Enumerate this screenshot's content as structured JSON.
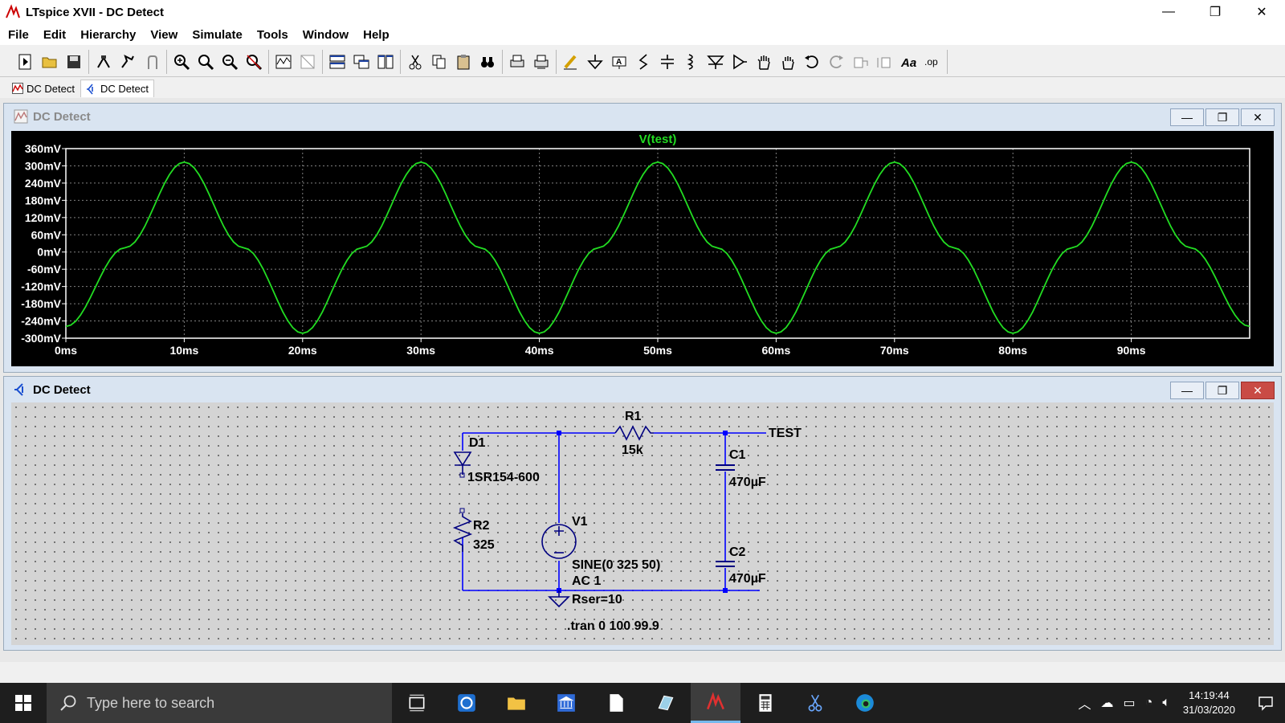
{
  "window": {
    "title": "LTspice XVII - DC Detect",
    "minimize": "—",
    "maximize": "❐",
    "close": "✕"
  },
  "menu": [
    "File",
    "Edit",
    "Hierarchy",
    "View",
    "Simulate",
    "Tools",
    "Window",
    "Help"
  ],
  "toolbar_icons": [
    [
      "new-schematic-icon",
      "open-icon",
      "save-icon"
    ],
    [
      "control-panel-icon",
      "run-icon",
      "halt-icon"
    ],
    [
      "zoom-in-icon",
      "zoom-fit-icon",
      "zoom-out-icon",
      "zoom-cancel-icon"
    ],
    [
      "autorange-icon",
      "waveform-pane-icon"
    ],
    [
      "tile-horizontal-icon",
      "cascade-icon",
      "tile-vertical-icon"
    ],
    [
      "cut-icon",
      "copy-icon",
      "paste-icon",
      "find-icon"
    ],
    [
      "print-icon",
      "print-preview-icon"
    ],
    [
      "draw-wire-icon",
      "ground-icon",
      "label-net-icon",
      "resistor-icon",
      "capacitor-icon",
      "inductor-icon",
      "diode-icon",
      "component-icon",
      "move-icon",
      "drag-icon",
      "undo-icon",
      "redo-icon",
      "rotate-icon",
      "mirror-icon",
      "text-icon",
      "spice-directive-icon"
    ]
  ],
  "tabs": [
    {
      "label": "DC Detect",
      "kind": "waveform"
    },
    {
      "label": "DC Detect",
      "kind": "schematic"
    }
  ],
  "plot_window": {
    "title": "DC Detect"
  },
  "schematic_window": {
    "title": "DC Detect"
  },
  "chart_data": {
    "type": "line",
    "title": "V(test)",
    "series": [
      {
        "name": "V(test)",
        "color": "#22dd22",
        "x": [
          0,
          5,
          10,
          15,
          20,
          25,
          30,
          35,
          40,
          45,
          50,
          55,
          60,
          65,
          70,
          75,
          80,
          85,
          90,
          95,
          100
        ],
        "y": [
          -259,
          15,
          313,
          15,
          -283,
          15,
          313,
          15,
          -283,
          15,
          313,
          15,
          -283,
          15,
          313,
          15,
          -283,
          15,
          313,
          15,
          -259
        ]
      }
    ],
    "x_ticks": [
      "0ms",
      "10ms",
      "20ms",
      "30ms",
      "40ms",
      "50ms",
      "60ms",
      "70ms",
      "80ms",
      "90ms"
    ],
    "x_tick_values": [
      0,
      10,
      20,
      30,
      40,
      50,
      60,
      70,
      80,
      90
    ],
    "y_ticks": [
      "360mV",
      "300mV",
      "240mV",
      "180mV",
      "120mV",
      "60mV",
      "0mV",
      "-60mV",
      "-120mV",
      "-180mV",
      "-240mV",
      "-300mV"
    ],
    "y_tick_values": [
      360,
      300,
      240,
      180,
      120,
      60,
      0,
      -60,
      -120,
      -180,
      -240,
      -300
    ],
    "xlim": [
      0,
      100
    ],
    "ylim": [
      -300,
      360
    ],
    "grid": true,
    "colors": {
      "background": "#000000",
      "grid": "#808080",
      "axis_text": "#ffffff",
      "trace": "#22dd22"
    }
  },
  "schematic": {
    "components": {
      "D1": {
        "name": "D1",
        "value": "1SR154-600"
      },
      "R1": {
        "name": "R1",
        "value": "15k"
      },
      "R2": {
        "name": "R2",
        "value": "325"
      },
      "C1": {
        "name": "C1",
        "value": "470µF"
      },
      "C2": {
        "name": "C2",
        "value": "470µF"
      },
      "V1": {
        "name": "V1",
        "value": "SINE(0 325 50)",
        "ac": "AC 1",
        "rser": "Rser=10"
      }
    },
    "net_label": "TEST",
    "directive": ".tran 0 100 99.9",
    "colors": {
      "wire": "#0000ff",
      "component": "#000080",
      "text": "#000000"
    }
  },
  "taskbar": {
    "search_placeholder": "Type here to search",
    "time": "14:19:44",
    "date": "31/03/2020",
    "apps": [
      "task-view-icon",
      "sync-app-icon",
      "file-explorer-icon",
      "bank-app-icon",
      "document-icon",
      "notepad-icon",
      "ltspice-icon",
      "calculator-icon",
      "snipping-tool-icon",
      "edge-icon"
    ]
  }
}
